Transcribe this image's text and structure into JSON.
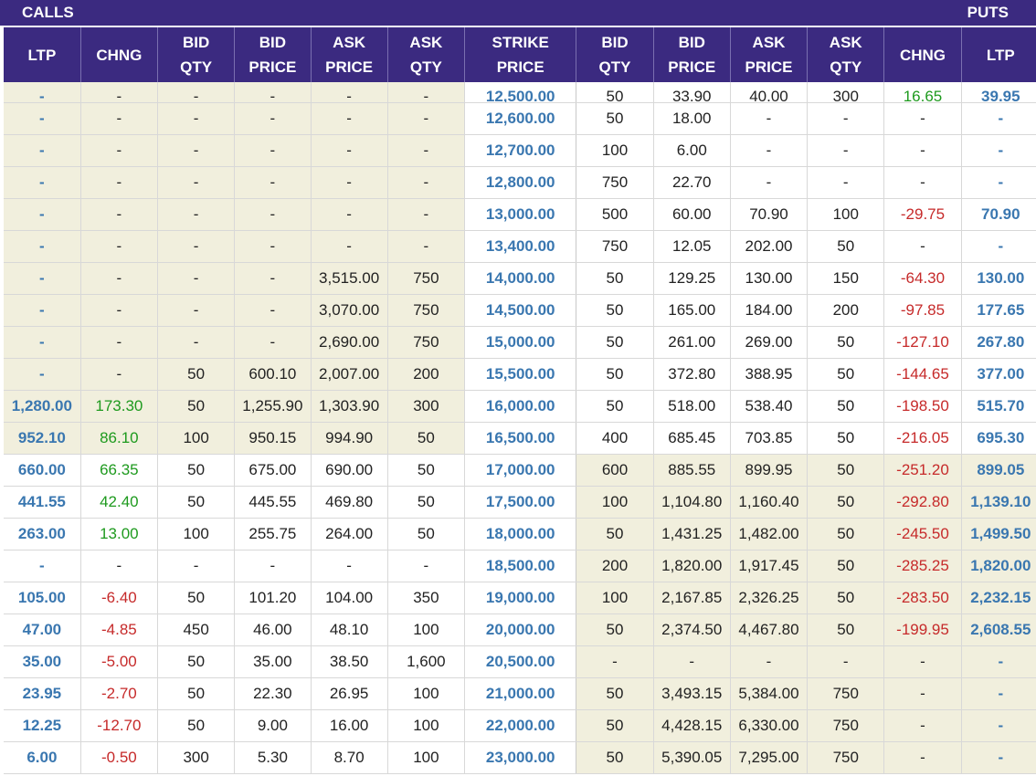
{
  "header": {
    "calls_label": "CALLS",
    "puts_label": "PUTS",
    "columns": [
      [
        "LTP"
      ],
      [
        "CHNG"
      ],
      [
        "BID",
        "QTY"
      ],
      [
        "BID",
        "PRICE"
      ],
      [
        "ASK",
        "PRICE"
      ],
      [
        "ASK",
        "QTY"
      ],
      [
        "STRIKE",
        "PRICE"
      ],
      [
        "BID",
        "QTY"
      ],
      [
        "BID",
        "PRICE"
      ],
      [
        "ASK",
        "PRICE"
      ],
      [
        "ASK",
        "QTY"
      ],
      [
        "CHNG"
      ],
      [
        "LTP"
      ]
    ]
  },
  "colors": {
    "header_bg": "#3b2a80",
    "itm_bg": "#f1efdd",
    "link_blue": "#3a77b0",
    "positive": "#1e9a1e",
    "negative": "#c62a2a"
  },
  "rows": [
    {
      "call": [
        "-",
        "-",
        "-",
        "-",
        "-",
        "-"
      ],
      "strike": "12,500.00",
      "put": [
        "50",
        "33.90",
        "40.00",
        "300",
        "16.65",
        "39.95"
      ],
      "call_itm": true,
      "put_itm": false,
      "partial": true
    },
    {
      "call": [
        "-",
        "-",
        "-",
        "-",
        "-",
        "-"
      ],
      "strike": "12,600.00",
      "put": [
        "50",
        "18.00",
        "-",
        "-",
        "-",
        "-"
      ],
      "call_itm": true,
      "put_itm": false
    },
    {
      "call": [
        "-",
        "-",
        "-",
        "-",
        "-",
        "-"
      ],
      "strike": "12,700.00",
      "put": [
        "100",
        "6.00",
        "-",
        "-",
        "-",
        "-"
      ],
      "call_itm": true,
      "put_itm": false
    },
    {
      "call": [
        "-",
        "-",
        "-",
        "-",
        "-",
        "-"
      ],
      "strike": "12,800.00",
      "put": [
        "750",
        "22.70",
        "-",
        "-",
        "-",
        "-"
      ],
      "call_itm": true,
      "put_itm": false
    },
    {
      "call": [
        "-",
        "-",
        "-",
        "-",
        "-",
        "-"
      ],
      "strike": "13,000.00",
      "put": [
        "500",
        "60.00",
        "70.90",
        "100",
        "-29.75",
        "70.90"
      ],
      "call_itm": true,
      "put_itm": false
    },
    {
      "call": [
        "-",
        "-",
        "-",
        "-",
        "-",
        "-"
      ],
      "strike": "13,400.00",
      "put": [
        "750",
        "12.05",
        "202.00",
        "50",
        "-",
        "-"
      ],
      "call_itm": true,
      "put_itm": false
    },
    {
      "call": [
        "-",
        "-",
        "-",
        "-",
        "3,515.00",
        "750"
      ],
      "strike": "14,000.00",
      "put": [
        "50",
        "129.25",
        "130.00",
        "150",
        "-64.30",
        "130.00"
      ],
      "call_itm": true,
      "put_itm": false
    },
    {
      "call": [
        "-",
        "-",
        "-",
        "-",
        "3,070.00",
        "750"
      ],
      "strike": "14,500.00",
      "put": [
        "50",
        "165.00",
        "184.00",
        "200",
        "-97.85",
        "177.65"
      ],
      "call_itm": true,
      "put_itm": false
    },
    {
      "call": [
        "-",
        "-",
        "-",
        "-",
        "2,690.00",
        "750"
      ],
      "strike": "15,000.00",
      "put": [
        "50",
        "261.00",
        "269.00",
        "50",
        "-127.10",
        "267.80"
      ],
      "call_itm": true,
      "put_itm": false
    },
    {
      "call": [
        "-",
        "-",
        "50",
        "600.10",
        "2,007.00",
        "200"
      ],
      "strike": "15,500.00",
      "put": [
        "50",
        "372.80",
        "388.95",
        "50",
        "-144.65",
        "377.00"
      ],
      "call_itm": true,
      "put_itm": false
    },
    {
      "call": [
        "1,280.00",
        "173.30",
        "50",
        "1,255.90",
        "1,303.90",
        "300"
      ],
      "strike": "16,000.00",
      "put": [
        "50",
        "518.00",
        "538.40",
        "50",
        "-198.50",
        "515.70"
      ],
      "call_itm": true,
      "put_itm": false
    },
    {
      "call": [
        "952.10",
        "86.10",
        "100",
        "950.15",
        "994.90",
        "50"
      ],
      "strike": "16,500.00",
      "put": [
        "400",
        "685.45",
        "703.85",
        "50",
        "-216.05",
        "695.30"
      ],
      "call_itm": true,
      "put_itm": false
    },
    {
      "call": [
        "660.00",
        "66.35",
        "50",
        "675.00",
        "690.00",
        "50"
      ],
      "strike": "17,000.00",
      "put": [
        "600",
        "885.55",
        "899.95",
        "50",
        "-251.20",
        "899.05"
      ],
      "call_itm": false,
      "put_itm": true
    },
    {
      "call": [
        "441.55",
        "42.40",
        "50",
        "445.55",
        "469.80",
        "50"
      ],
      "strike": "17,500.00",
      "put": [
        "100",
        "1,104.80",
        "1,160.40",
        "50",
        "-292.80",
        "1,139.10"
      ],
      "call_itm": false,
      "put_itm": true
    },
    {
      "call": [
        "263.00",
        "13.00",
        "100",
        "255.75",
        "264.00",
        "50"
      ],
      "strike": "18,000.00",
      "put": [
        "50",
        "1,431.25",
        "1,482.00",
        "50",
        "-245.50",
        "1,499.50"
      ],
      "call_itm": false,
      "put_itm": true
    },
    {
      "call": [
        "-",
        "-",
        "-",
        "-",
        "-",
        "-"
      ],
      "strike": "18,500.00",
      "put": [
        "200",
        "1,820.00",
        "1,917.45",
        "50",
        "-285.25",
        "1,820.00"
      ],
      "call_itm": false,
      "put_itm": true
    },
    {
      "call": [
        "105.00",
        "-6.40",
        "50",
        "101.20",
        "104.00",
        "350"
      ],
      "strike": "19,000.00",
      "put": [
        "100",
        "2,167.85",
        "2,326.25",
        "50",
        "-283.50",
        "2,232.15"
      ],
      "call_itm": false,
      "put_itm": true
    },
    {
      "call": [
        "47.00",
        "-4.85",
        "450",
        "46.00",
        "48.10",
        "100"
      ],
      "strike": "20,000.00",
      "put": [
        "50",
        "2,374.50",
        "4,467.80",
        "50",
        "-199.95",
        "2,608.55"
      ],
      "call_itm": false,
      "put_itm": true
    },
    {
      "call": [
        "35.00",
        "-5.00",
        "50",
        "35.00",
        "38.50",
        "1,600"
      ],
      "strike": "20,500.00",
      "put": [
        "-",
        "-",
        "-",
        "-",
        "-",
        "-"
      ],
      "call_itm": false,
      "put_itm": true
    },
    {
      "call": [
        "23.95",
        "-2.70",
        "50",
        "22.30",
        "26.95",
        "100"
      ],
      "strike": "21,000.00",
      "put": [
        "50",
        "3,493.15",
        "5,384.00",
        "750",
        "-",
        "-"
      ],
      "call_itm": false,
      "put_itm": true
    },
    {
      "call": [
        "12.25",
        "-12.70",
        "50",
        "9.00",
        "16.00",
        "100"
      ],
      "strike": "22,000.00",
      "put": [
        "50",
        "4,428.15",
        "6,330.00",
        "750",
        "-",
        "-"
      ],
      "call_itm": false,
      "put_itm": true
    },
    {
      "call": [
        "6.00",
        "-0.50",
        "300",
        "5.30",
        "8.70",
        "100"
      ],
      "strike": "23,000.00",
      "put": [
        "50",
        "5,390.05",
        "7,295.00",
        "750",
        "-",
        "-"
      ],
      "call_itm": false,
      "put_itm": true
    }
  ]
}
